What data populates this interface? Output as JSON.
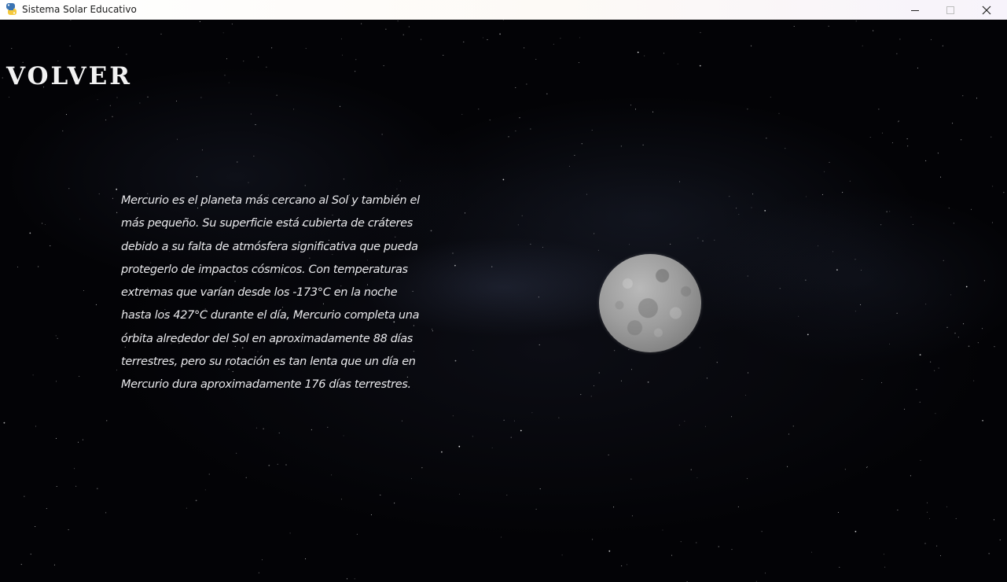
{
  "window": {
    "title": "Sistema Solar Educativo",
    "app_icon": "python-icon",
    "controls": {
      "minimize_icon": "minimize-icon",
      "maximize_icon": "maximize-icon",
      "close_icon": "close-icon"
    }
  },
  "page": {
    "back_label": "VOLVER",
    "description": "Mercurio es el planeta más cercano al Sol y también el más pequeño. Su superficie está cubierta de cráteres debido a su falta de atmósfera significativa que pueda protegerlo de impactos cósmicos. Con temperaturas extremas que varían desde los -173°C en la noche hasta los 427°C durante el día, Mercurio completa una órbita alrededor del Sol en aproximadamente 88 días terrestres, pero su rotación es tan lenta que un día en Mercurio dura aproximadamente 176 días terrestres.",
    "planet_image": "mercury-planet"
  },
  "colors": {
    "background": "#030306",
    "text": "#e9e9ec",
    "titlebar": "#ffffff",
    "planet": "#9d9d9d"
  }
}
